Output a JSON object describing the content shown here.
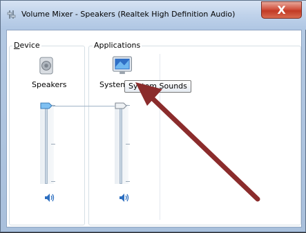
{
  "window": {
    "title": "Volume Mixer - Speakers (Realtek High Definition Audio)",
    "close_label": "X"
  },
  "device": {
    "group_label_u": "D",
    "group_label_rest": "evice",
    "name": "Speakers",
    "icon": "speaker-device-icon"
  },
  "applications": {
    "group_label": "Applications",
    "items": [
      {
        "name": "System",
        "icon": "system-sounds-icon"
      }
    ]
  },
  "tooltip": {
    "text": "System Sounds"
  },
  "colors": {
    "arrow": "#8b2c2c",
    "slider_thumb_active": "#5aa0e0",
    "close_button": "#c23a25"
  }
}
